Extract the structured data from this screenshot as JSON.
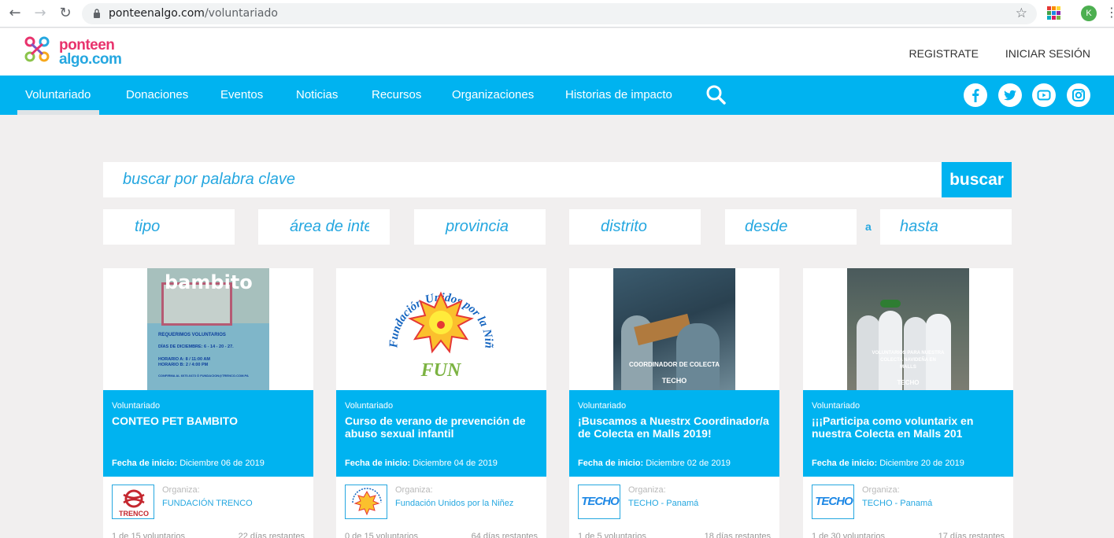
{
  "browser": {
    "url_domain": "ponteenalgo.com",
    "url_path": "/voluntariado",
    "avatar_letter": "K",
    "back_glyph": "←",
    "forward_glyph": "→",
    "reload_glyph": "↻",
    "star_glyph": "☆",
    "menu_glyph": "⋮"
  },
  "header": {
    "logo_line1": "ponteen",
    "logo_line2": "algo.com",
    "register": "REGISTRATE",
    "login": "INICIAR SESIÓN"
  },
  "nav": {
    "items": [
      "Voluntariado",
      "Donaciones",
      "Eventos",
      "Noticias",
      "Recursos",
      "Organizaciones",
      "Historias de impacto"
    ],
    "active": "Voluntariado"
  },
  "social": [
    "facebook-icon",
    "twitter-icon",
    "youtube-icon",
    "instagram-icon"
  ],
  "search": {
    "placeholder": "buscar por palabra clave",
    "button": "buscar"
  },
  "filters": {
    "tipo": "tipo",
    "area": "área de interés",
    "provincia": "provincia",
    "distrito": "distrito",
    "desde": "desde",
    "separator": "a",
    "hasta": "hasta"
  },
  "cards": [
    {
      "type": "Voluntariado",
      "title": "CONTEO PET BAMBITO",
      "date_label": "Fecha de inicio:",
      "date": "Diciembre 06 de 2019",
      "org_label": "Organiza:",
      "org_name": "FUNDACIÓN TRENCO",
      "volunteers": "1 de 15 voluntarios",
      "remaining": "22 días restantes",
      "image_lines": [
        "REQUERIMOS VOLUNTARIOS",
        "DÍAS DE DICIEMBRE: 6 - 14 - 20 - 27.",
        "HORARIO A: 8 / 11:00 AM",
        "HORARIO B: 2 / 4:00 PM",
        "CONFIRMA AL 6070-0473 Ó FUNDACION@TRENCO.COM.PA"
      ],
      "image_brand": "bambito",
      "org_logo_text": "TRENCO"
    },
    {
      "type": "Voluntariado",
      "title": "Curso de verano de prevención de abuso sexual infantil",
      "date_label": "Fecha de inicio:",
      "date": "Diciembre 04 de 2019",
      "org_label": "Organiza:",
      "org_name": "Fundación Unidos por la Niñez",
      "volunteers": "0 de 15 voluntarios",
      "remaining": "64 días restantes",
      "image_arc": "Fundación Unidos por la Niñez",
      "image_brand": "FUN"
    },
    {
      "type": "Voluntariado",
      "title": "¡Buscamos a Nuestrx Coordinador/a de Colecta en Malls 2019!",
      "date_label": "Fecha de inicio:",
      "date": "Diciembre 02 de 2019",
      "org_label": "Organiza:",
      "org_name": "TECHO - Panamá",
      "volunteers": "1 de 5 voluntarios",
      "remaining": "18 días restantes",
      "image_lines": [
        "COORDINADOR DE COLECTA"
      ],
      "image_brand": "TECHO",
      "org_logo_text": "TECHO"
    },
    {
      "type": "Voluntariado",
      "title": "¡¡¡Participa como voluntarix en nuestra Colecta en Malls 201",
      "date_label": "Fecha de inicio:",
      "date": "Diciembre 20 de 2019",
      "org_label": "Organiza:",
      "org_name": "TECHO - Panamá",
      "volunteers": "1 de 30 voluntarios",
      "remaining": "17 días restantes",
      "image_lines": [
        "VOLUNTARIOS PARA NUESTRA",
        "COLECTA NAVIDEÑA EN",
        "MALLS"
      ],
      "image_brand": "TECHO",
      "org_logo_text": "TECHO"
    }
  ],
  "colors": {
    "brand_blue": "#00b3f0",
    "link_blue": "#25a7e0",
    "page_bg": "#f1efef"
  }
}
